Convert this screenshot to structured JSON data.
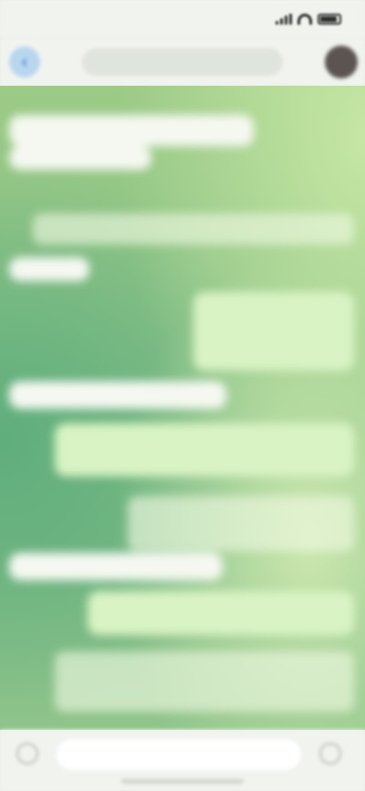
{
  "status_bar": {
    "time": "",
    "network": ""
  },
  "header": {
    "title": "",
    "subtitle": ""
  },
  "composer": {
    "placeholder": ""
  },
  "colors": {
    "status_bar_bg": "#f1f3ef",
    "wallpaper_dark": "#5fae7c",
    "wallpaper_light": "#c6e6a4",
    "incoming_bubble": "#f5f8f1",
    "outgoing_bubble": "#d9f3c4",
    "back_button": "#b9d6ef",
    "avatar": "#5c5450"
  },
  "icons": {
    "back": "chevron-left-icon",
    "attach": "paperclip-icon",
    "mic": "microphone-icon"
  }
}
